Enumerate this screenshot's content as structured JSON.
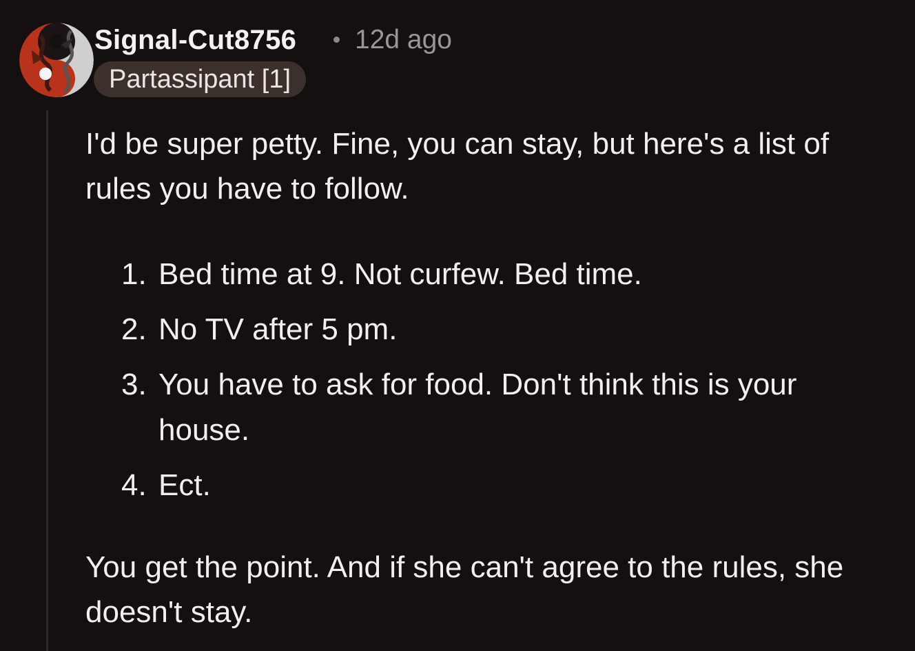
{
  "comment": {
    "author": "Signal-Cut8756",
    "separator": "·",
    "time_ago": "12d ago",
    "flair": "Partassipant [1]",
    "avatar_icon": "yin-yang-dragon-avatar-icon",
    "paragraphs": [
      "I'd be super petty. Fine, you can stay, but here's a list of rules you have to follow.",
      "You get the point. And if she can't agree to the rules, she doesn't stay."
    ],
    "rules": [
      {
        "number": "1.",
        "text": "Bed time at 9. Not curfew. Bed time."
      },
      {
        "number": "2.",
        "text": "No TV after 5 pm."
      },
      {
        "number": "3.",
        "text": "You have to ask for food. Don't think this is your house."
      },
      {
        "number": "4.",
        "text": "Ect."
      }
    ]
  },
  "colors": {
    "background": "#141010",
    "text": "#f2efee",
    "muted": "#9d9594",
    "flair_bg": "#3c302c",
    "thread_line": "#2c2626",
    "avatar_red": "#b8321c"
  }
}
